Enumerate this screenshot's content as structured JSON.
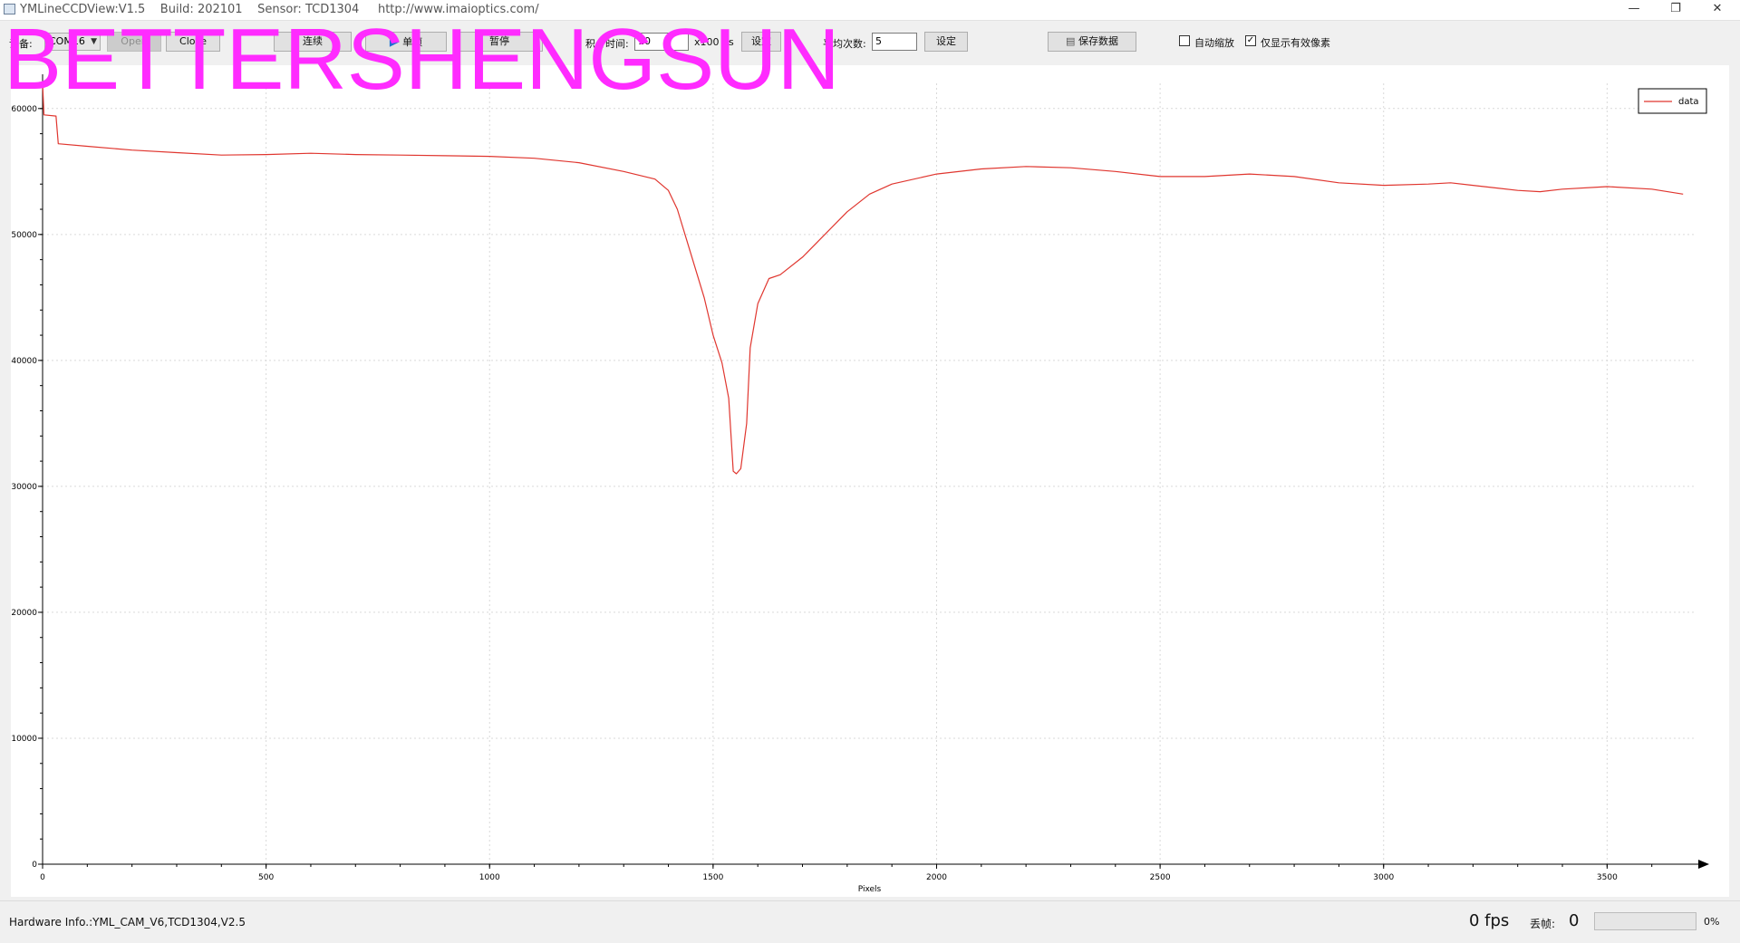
{
  "window": {
    "title": "YMLineCCDView:V1.5    Build: 202101    Sensor: TCD1304     http://www.imaioptics.com/",
    "min_glyph": "—",
    "restore_glyph": "❐",
    "close_glyph": "✕"
  },
  "toolbar": {
    "device_label": "设备:",
    "device_value": "COM16",
    "open_label": "Open",
    "close_label": "Close",
    "continuous_label": "连续",
    "single_label": "单帧",
    "pause_label": "暂停",
    "integration_label": "积分时间:",
    "integration_value": "10",
    "integration_unit": "x100 us",
    "set_label": "设定",
    "average_label": "平均次数:",
    "average_value": "5",
    "set2_label": "设定",
    "save_label": "保存数据",
    "auto_zoom_label": "自动缩放",
    "auto_zoom_checked": false,
    "valid_pixels_label": "仅显示有效像素",
    "valid_pixels_checked": true,
    "save_icon": "save-icon",
    "play_icon": "play-icon"
  },
  "watermark": "BETTERSHENGSUN",
  "chart_data": {
    "type": "line",
    "xlabel": "Pixels",
    "ylabel": "",
    "xlim": [
      0,
      3700
    ],
    "ylim": [
      0,
      62000
    ],
    "xticks": [
      0,
      500,
      1000,
      1500,
      2000,
      2500,
      3000,
      3500
    ],
    "yticks": [
      0,
      10000,
      20000,
      30000,
      40000,
      50000,
      60000
    ],
    "grid": true,
    "legend": "top-right",
    "series": [
      {
        "name": "data",
        "color": "#e0362f",
        "points": [
          [
            0,
            62000
          ],
          [
            3,
            59500
          ],
          [
            30,
            59400
          ],
          [
            35,
            57200
          ],
          [
            100,
            57000
          ],
          [
            200,
            56700
          ],
          [
            300,
            56500
          ],
          [
            400,
            56300
          ],
          [
            500,
            56350
          ],
          [
            600,
            56450
          ],
          [
            700,
            56350
          ],
          [
            800,
            56300
          ],
          [
            900,
            56250
          ],
          [
            1000,
            56200
          ],
          [
            1100,
            56050
          ],
          [
            1200,
            55700
          ],
          [
            1300,
            55000
          ],
          [
            1370,
            54400
          ],
          [
            1400,
            53500
          ],
          [
            1420,
            52000
          ],
          [
            1450,
            48500
          ],
          [
            1480,
            45000
          ],
          [
            1500,
            42000
          ],
          [
            1520,
            39800
          ],
          [
            1535,
            37000
          ],
          [
            1545,
            31200
          ],
          [
            1552,
            31000
          ],
          [
            1562,
            31400
          ],
          [
            1575,
            35000
          ],
          [
            1583,
            41000
          ],
          [
            1600,
            44500
          ],
          [
            1625,
            46500
          ],
          [
            1650,
            46800
          ],
          [
            1700,
            48200
          ],
          [
            1750,
            50000
          ],
          [
            1800,
            51800
          ],
          [
            1850,
            53200
          ],
          [
            1900,
            54000
          ],
          [
            2000,
            54800
          ],
          [
            2100,
            55200
          ],
          [
            2200,
            55400
          ],
          [
            2300,
            55300
          ],
          [
            2400,
            55000
          ],
          [
            2500,
            54600
          ],
          [
            2600,
            54600
          ],
          [
            2700,
            54800
          ],
          [
            2800,
            54600
          ],
          [
            2900,
            54100
          ],
          [
            3000,
            53900
          ],
          [
            3100,
            54000
          ],
          [
            3150,
            54100
          ],
          [
            3200,
            53900
          ],
          [
            3300,
            53500
          ],
          [
            3350,
            53400
          ],
          [
            3400,
            53600
          ],
          [
            3500,
            53800
          ],
          [
            3600,
            53600
          ],
          [
            3670,
            53200
          ]
        ]
      }
    ]
  },
  "status": {
    "hardware_info": "Hardware Info.:YML_CAM_V6,TCD1304,V2.5",
    "fps": "0 fps",
    "drop_label": "丢帧:",
    "drop_value": "0",
    "progress_text": "0%",
    "progress_fraction": 0
  }
}
